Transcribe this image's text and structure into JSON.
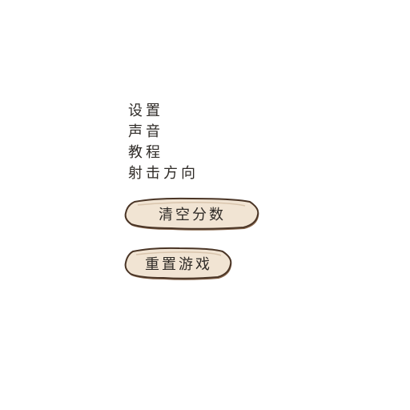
{
  "menu": {
    "items": [
      {
        "label": "设置"
      },
      {
        "label": "声音"
      },
      {
        "label": "教程"
      },
      {
        "label": "射击方向"
      }
    ]
  },
  "buttons": {
    "clear_score": "清空分数",
    "reset_game": "重置游戏"
  },
  "colors": {
    "button_fill": "#f1e4d3",
    "button_outline": "#4a3526",
    "button_shadow": "#8a6a4f",
    "text": "#2f2b27"
  }
}
